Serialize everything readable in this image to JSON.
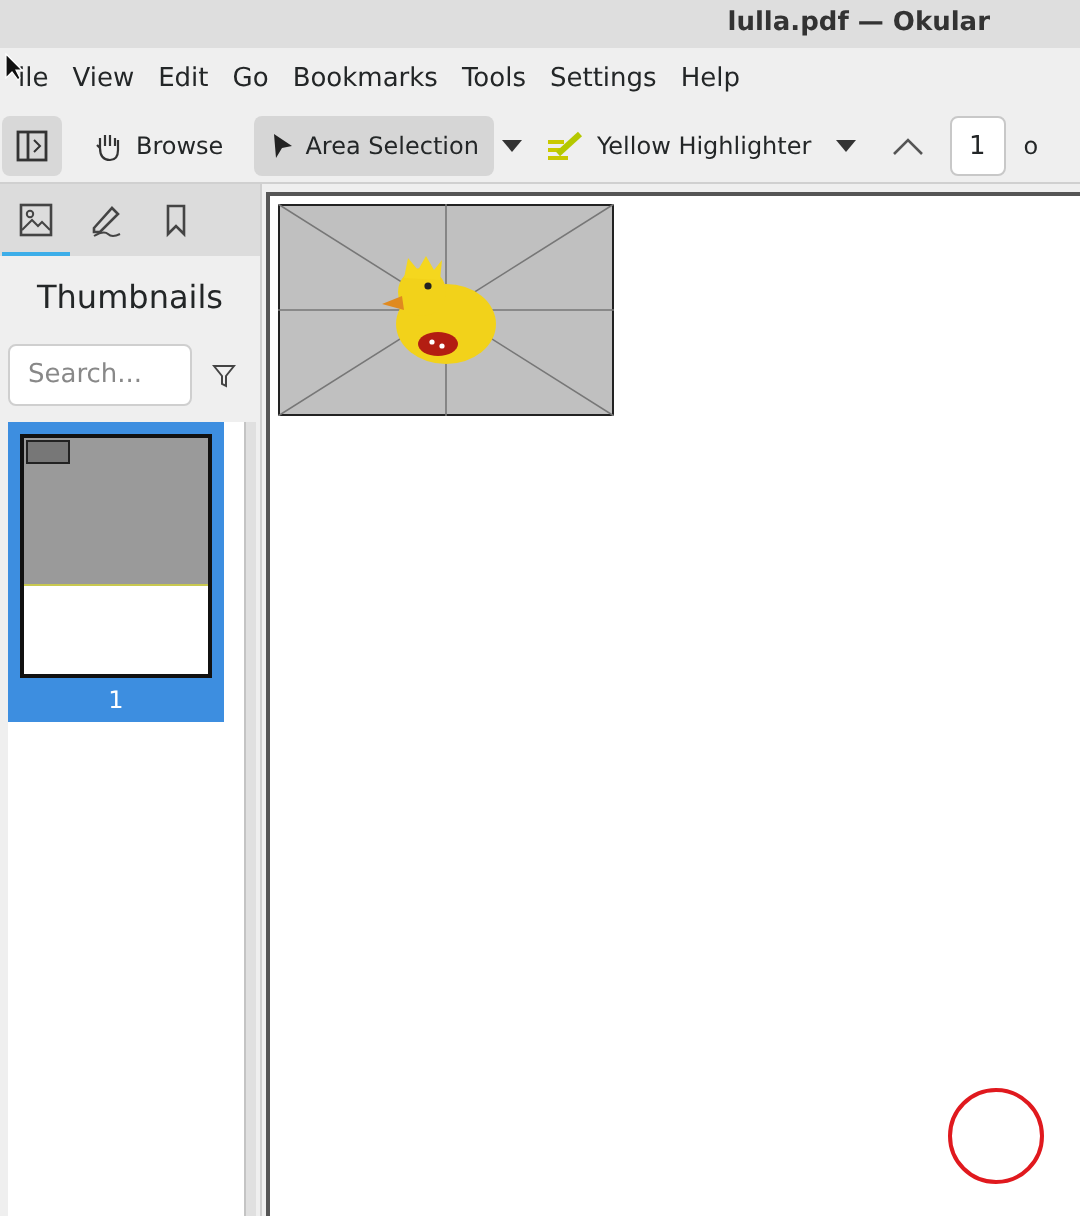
{
  "window": {
    "title": "lulla.pdf — Okular"
  },
  "menu": [
    "ile",
    "View",
    "Edit",
    "Go",
    "Bookmarks",
    "Tools",
    "Settings",
    "Help"
  ],
  "toolbar": {
    "browse": "Browse",
    "area_selection": {
      "label": "Area Selection",
      "selected": true
    },
    "highlighter": "Yellow Highlighter",
    "page_number": "1",
    "page_of": "o"
  },
  "sidebar": {
    "tabs": [
      {
        "kind": "thumbnails",
        "selected": true
      },
      {
        "kind": "annotations",
        "selected": false
      },
      {
        "kind": "bookmarks",
        "selected": false
      }
    ],
    "title": "Thumbnails",
    "search": {
      "placeholder": "Search..."
    },
    "thumbnails": [
      {
        "label": "1",
        "selected": true
      }
    ]
  }
}
